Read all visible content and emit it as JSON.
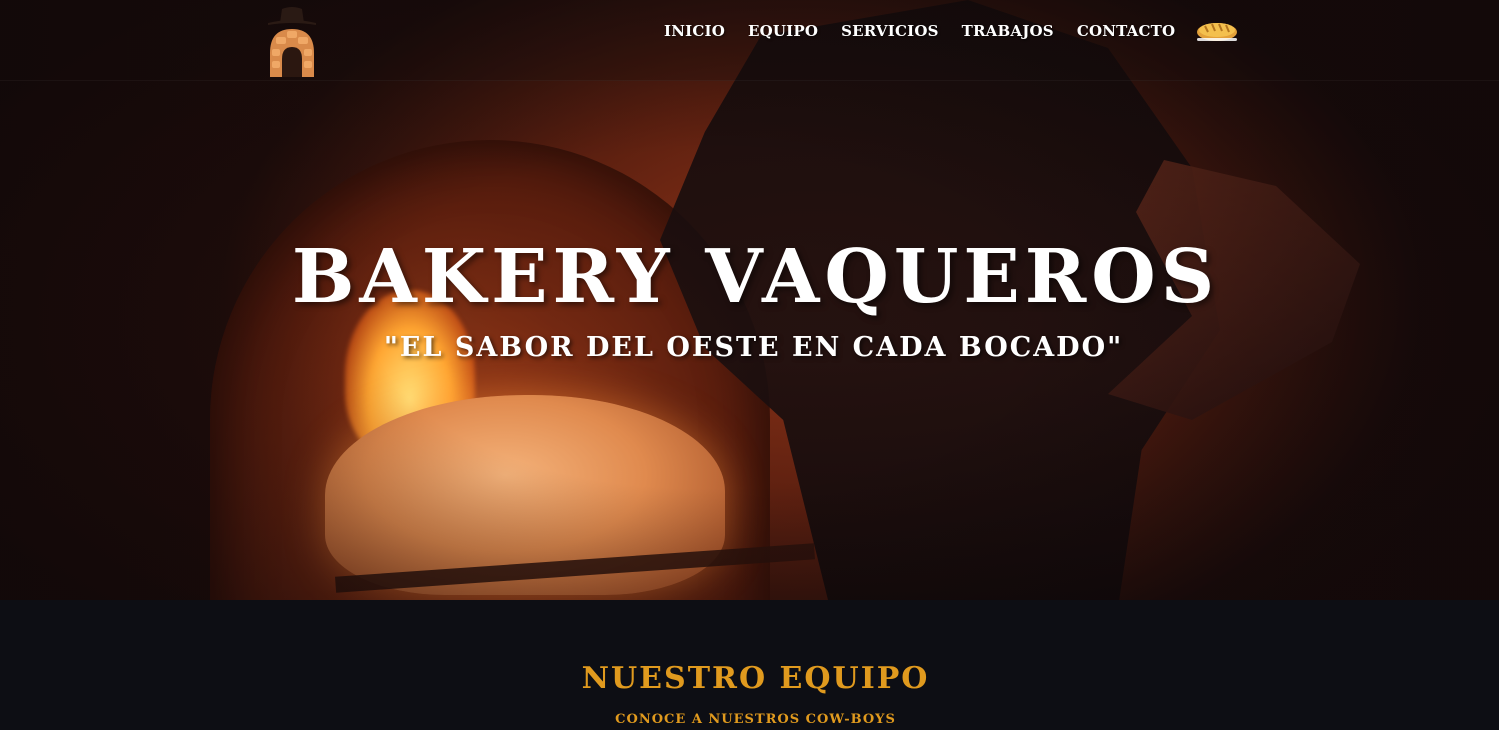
{
  "header": {
    "logo_icon": "baker-oven-logo-icon",
    "nav_items": [
      "INICIO",
      "EQUIPO",
      "SERVICIOS",
      "TRABAJOS",
      "CONTACTO"
    ],
    "cart_icon": "bread-icon"
  },
  "hero": {
    "title": "BAKERY VAQUEROS",
    "subtitle": "\"EL SABOR DEL OESTE EN CADA BOCADO\""
  },
  "team": {
    "title": "NUESTRO EQUIPO",
    "subtitle": "CONOCE A NUESTROS COW-BOYS"
  },
  "colors": {
    "accent": "#e09a1e",
    "dark_bg": "#0d0e14",
    "hero_text": "#ffffff"
  }
}
